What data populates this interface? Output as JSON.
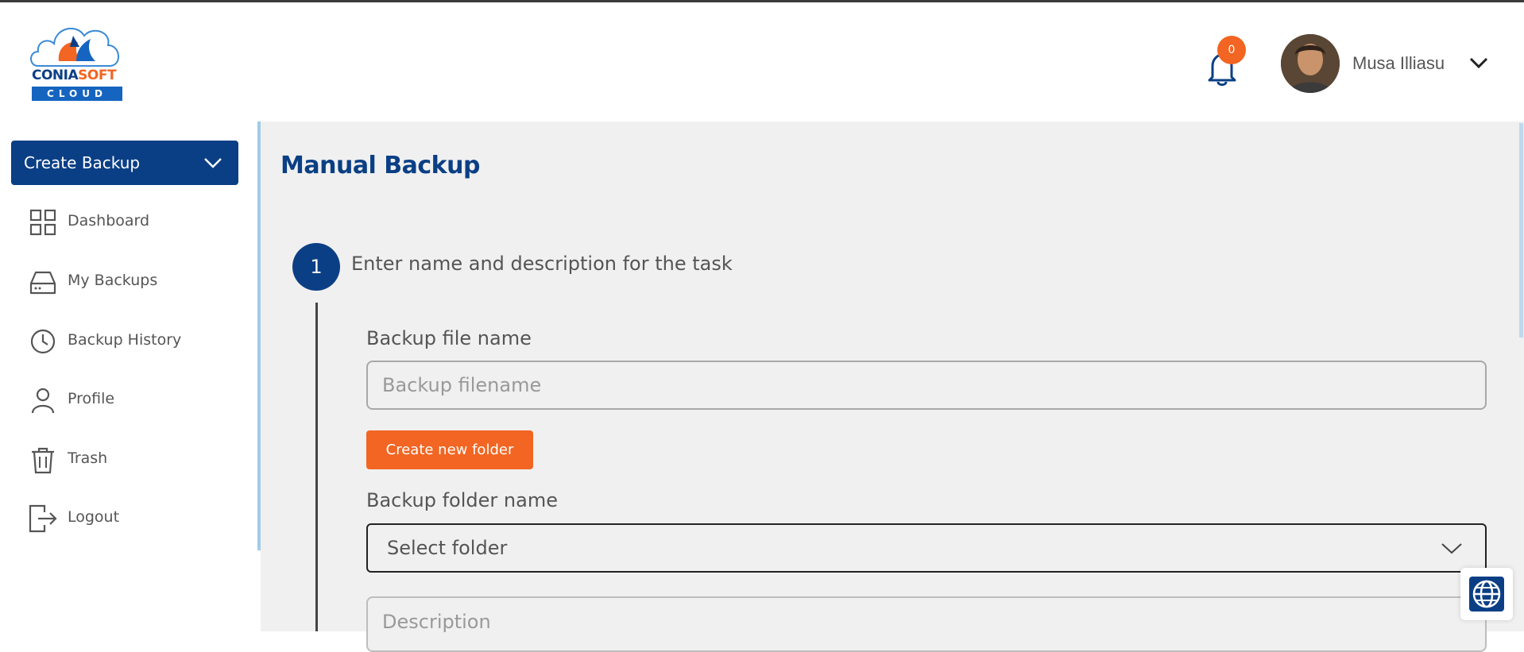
{
  "app": {
    "logo_text_primary": "CONIA",
    "logo_text_accent": "SOFT",
    "logo_subtext": "CLOUD"
  },
  "header": {
    "notification_count": "0",
    "user_name": "Musa Illiasu"
  },
  "sidebar": {
    "create_button_label": "Create Backup",
    "items": [
      {
        "label": "Dashboard",
        "icon": "dashboard-icon"
      },
      {
        "label": "My Backups",
        "icon": "hard-drive-icon"
      },
      {
        "label": "Backup History",
        "icon": "clock-icon"
      },
      {
        "label": "Profile",
        "icon": "user-icon"
      },
      {
        "label": "Trash",
        "icon": "trash-icon"
      },
      {
        "label": "Logout",
        "icon": "logout-icon"
      }
    ]
  },
  "main": {
    "page_title": "Manual Backup",
    "step": {
      "number": "1",
      "title": "Enter name and description for the task"
    },
    "backup_file_label": "Backup file name",
    "backup_file_placeholder": "Backup filename",
    "create_folder_button": "Create new folder",
    "backup_folder_label": "Backup folder name",
    "folder_select_value": "Select folder",
    "description_placeholder": "Description"
  },
  "colors": {
    "brand_navy": "#0b3f85",
    "accent_orange": "#f26522",
    "main_background": "#f0f0f0"
  }
}
